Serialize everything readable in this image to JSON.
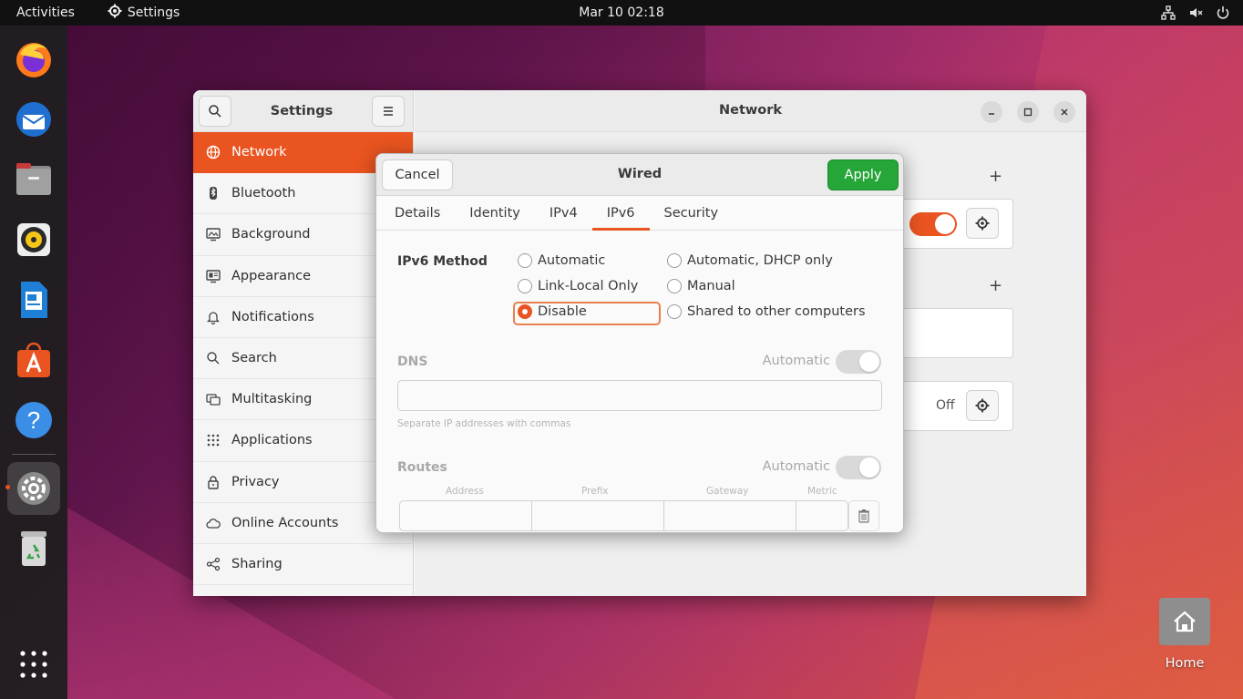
{
  "topbar": {
    "activities": "Activities",
    "app_name": "Settings",
    "clock": "Mar 10  02:18",
    "tray_icons": [
      "network-icon",
      "volume-muted-icon",
      "power-icon"
    ]
  },
  "dock": {
    "items": [
      "firefox-icon",
      "thunderbird-icon",
      "files-icon",
      "rhythmbox-icon",
      "writer-icon",
      "app-center-icon",
      "help-icon",
      "settings-icon",
      "trash-icon"
    ],
    "active": "settings-icon",
    "show_apps": "show-apps-grid-icon"
  },
  "settings_window": {
    "sidebar_title": "Settings",
    "content_title": "Network",
    "sidebar_items": [
      {
        "label": "Network",
        "icon": "network-icon"
      },
      {
        "label": "Bluetooth",
        "icon": "bluetooth-icon"
      },
      {
        "label": "Background",
        "icon": "background-icon"
      },
      {
        "label": "Appearance",
        "icon": "appearance-icon"
      },
      {
        "label": "Notifications",
        "icon": "bell-icon"
      },
      {
        "label": "Search",
        "icon": "search-icon"
      },
      {
        "label": "Multitasking",
        "icon": "multitasking-icon"
      },
      {
        "label": "Applications",
        "icon": "grid-icon"
      },
      {
        "label": "Privacy",
        "icon": "lock-icon"
      },
      {
        "label": "Online Accounts",
        "icon": "cloud-icon"
      },
      {
        "label": "Sharing",
        "icon": "share-icon"
      }
    ],
    "selected": "Network",
    "proxy_status": "Off"
  },
  "dialog": {
    "title": "Wired",
    "cancel": "Cancel",
    "apply": "Apply",
    "tabs": [
      "Details",
      "Identity",
      "IPv4",
      "IPv6",
      "Security"
    ],
    "active_tab": "IPv6",
    "ipv6_method_label": "IPv6 Method",
    "methods": {
      "automatic": "Automatic",
      "dhcp_only": "Automatic, DHCP only",
      "link_local": "Link-Local Only",
      "manual": "Manual",
      "disable": "Disable",
      "shared": "Shared to other computers"
    },
    "selected_method": "Disable",
    "dns": {
      "label": "DNS",
      "automatic_label": "Automatic",
      "value": "",
      "hint": "Separate IP addresses with commas"
    },
    "routes": {
      "label": "Routes",
      "automatic_label": "Automatic",
      "columns": [
        "Address",
        "Prefix",
        "Gateway",
        "Metric"
      ]
    }
  },
  "desktop": {
    "home_label": "Home"
  }
}
